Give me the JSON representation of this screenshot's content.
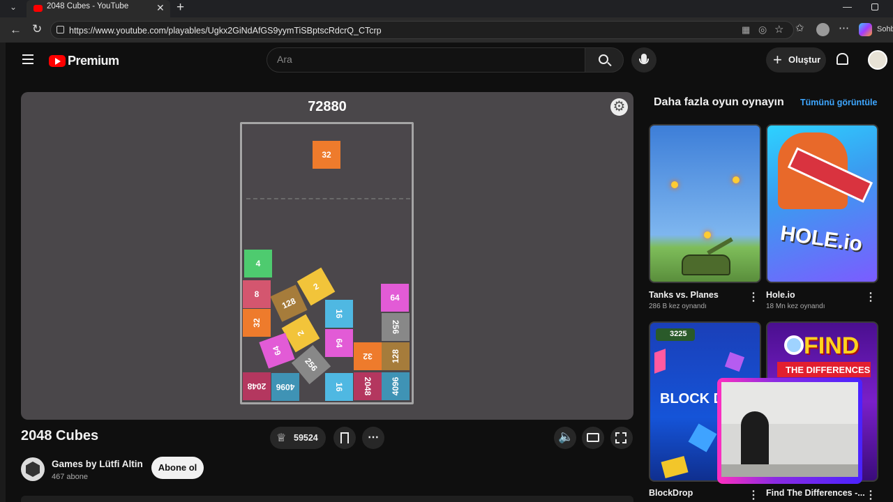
{
  "browser": {
    "tab_title": "2048 Cubes - YouTube",
    "url": "https://www.youtube.com/playables/Ugkx2GiNdAfGS9yymTiSBptscRdcrQ_CTcrp",
    "side_label": "Sohb"
  },
  "header": {
    "logo_text": "Premium",
    "search_placeholder": "Ara",
    "create_label": "Oluştur"
  },
  "game": {
    "score": "72880",
    "cubes": [
      {
        "v": "32",
        "color": "#ee7b2c"
      },
      {
        "v": "4",
        "color": "#4ecb6f"
      },
      {
        "v": "8",
        "color": "#d4566f"
      },
      {
        "v": "32",
        "color": "#ee7b2c"
      },
      {
        "v": "2048",
        "color": "#b4375f"
      },
      {
        "v": "128",
        "color": "#a67c3b"
      },
      {
        "v": "2",
        "color": "#f2c43a"
      },
      {
        "v": "2",
        "color": "#f2c43a"
      },
      {
        "v": "64",
        "color": "#e25bd6"
      },
      {
        "v": "256",
        "color": "#888888"
      },
      {
        "v": "4096",
        "color": "#3f93b5"
      },
      {
        "v": "16",
        "color": "#4fb8e2"
      },
      {
        "v": "64",
        "color": "#e25bd6"
      },
      {
        "v": "16",
        "color": "#4fb8e2"
      },
      {
        "v": "32",
        "color": "#ee7b2c"
      },
      {
        "v": "2048",
        "color": "#b4375f"
      },
      {
        "v": "64",
        "color": "#e25bd6"
      },
      {
        "v": "256",
        "color": "#888888"
      },
      {
        "v": "128",
        "color": "#a67c3b"
      },
      {
        "v": "4096",
        "color": "#3f93b5"
      }
    ]
  },
  "info": {
    "title": "2048 Cubes",
    "likes": "59524",
    "channel_name": "Games by Lütfi Altin",
    "channel_subs": "467 abone",
    "subscribe_label": "Abone ol"
  },
  "side": {
    "title": "Daha fazla oyun oynayın",
    "see_all": "Tümünü görüntüle",
    "games": [
      {
        "title": "Tanks vs. Planes",
        "plays": "286 B kez oynandı"
      },
      {
        "title": "Hole.io",
        "plays": "18 Mn kez oynandı"
      },
      {
        "title": "BlockDrop",
        "plays": ""
      },
      {
        "title": "Find The Differences -...",
        "plays": ""
      }
    ],
    "thumb_text": {
      "hole": "HOLE.io",
      "block_score": "3225",
      "block": "BLOCK D",
      "find": "FIND",
      "differences": "THE DIFFERENCES"
    }
  }
}
